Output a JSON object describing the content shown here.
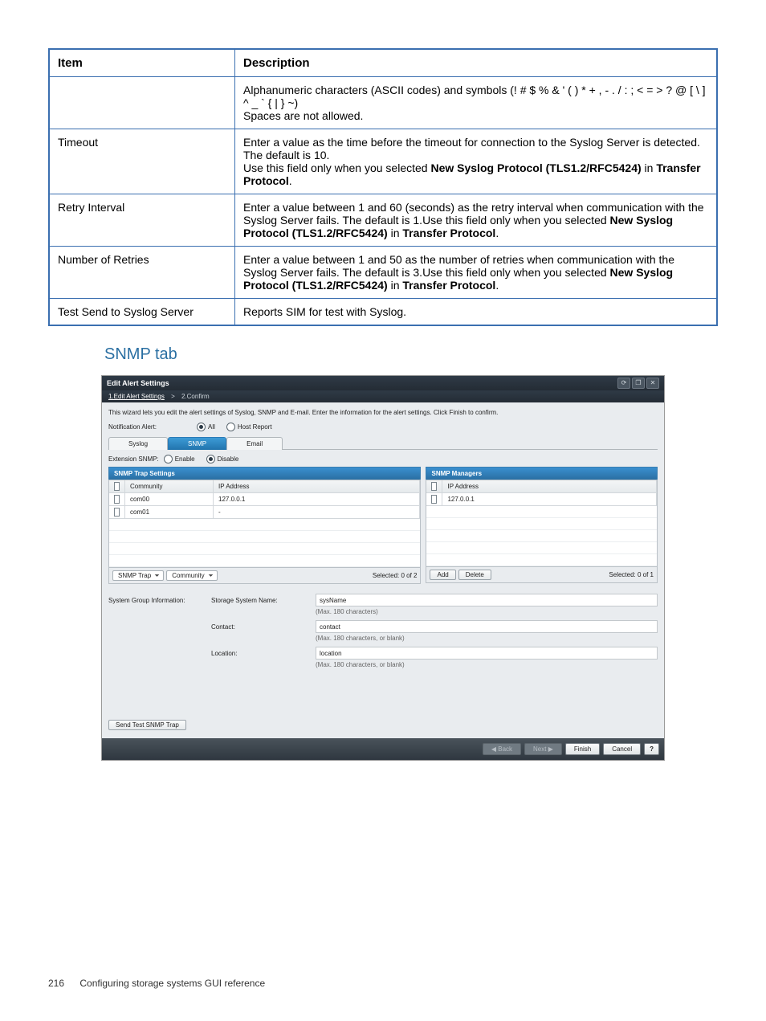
{
  "table": {
    "headers": [
      "Item",
      "Description"
    ],
    "rows": [
      {
        "item": "",
        "desc_html": "Alphanumeric characters (ASCII codes) and symbols (! # $ % & ' ( ) * + , - . / : ; < = > ? @ [ \\ ] ^ _ ` { | } ~)<br>Spaces are not allowed."
      },
      {
        "item": "Timeout",
        "desc_html": "Enter a value as the time before the timeout for connection to the Syslog Server is detected. The default is 10.<br>Use this field only when you selected <b>New Syslog Protocol (TLS1.2/RFC5424)</b> in <b>Transfer Protocol</b>."
      },
      {
        "item": "Retry Interval",
        "desc_html": "Enter a value between 1 and 60 (seconds) as the retry interval when communication with the Syslog Server fails. The default is 1.Use this field only when you selected <b>New Syslog Protocol (TLS1.2/RFC5424)</b> in <b>Transfer Protocol</b>."
      },
      {
        "item": "Number of Retries",
        "desc_html": "Enter a value between 1 and 50 as the number of retries when communication with the Syslog Server fails. The default is 3.Use this field only when you selected <b>New Syslog Protocol (TLS1.2/RFC5424)</b> in <b>Transfer Protocol</b>."
      },
      {
        "item": "Test Send to Syslog Server",
        "desc_html": "Reports SIM for test with Syslog."
      }
    ]
  },
  "section_heading": "SNMP tab",
  "dialog": {
    "title": "Edit Alert Settings",
    "breadcrumb": {
      "step1": "1.Edit Alert Settings",
      "sep": ">",
      "step2": "2.Confirm"
    },
    "wizard_text": "This wizard lets you edit the alert settings of Syslog, SNMP and E-mail. Enter the information for the alert settings. Click Finish to confirm.",
    "notif_alert_label": "Notification Alert:",
    "notif_all": "All",
    "notif_host": "Host Report",
    "tabs": {
      "syslog": "Syslog",
      "snmp": "SNMP",
      "email": "Email"
    },
    "ext_label": "Extension SNMP:",
    "ext_enable": "Enable",
    "ext_disable": "Disable",
    "trap_panel": {
      "title": "SNMP Trap Settings",
      "col1": "Community",
      "col2": "IP Address",
      "rows": [
        {
          "community": "com00",
          "ip": "127.0.0.1"
        },
        {
          "community": "com01",
          "ip": "-"
        }
      ],
      "dd1": "SNMP Trap",
      "dd2": "Community",
      "selected": "Selected: 0  of 2"
    },
    "mgr_panel": {
      "title": "SNMP Managers",
      "col1": "IP Address",
      "rows": [
        {
          "ip": "127.0.0.1"
        }
      ],
      "add": "Add",
      "delete": "Delete",
      "selected": "Selected: 0  of 1"
    },
    "sgi": {
      "heading": "System Group Information:",
      "name_label": "Storage System Name:",
      "name_value": "sysName",
      "name_hint": "(Max. 180 characters)",
      "contact_label": "Contact:",
      "contact_value": "contact",
      "contact_hint": "(Max. 180 characters, or blank)",
      "location_label": "Location:",
      "location_value": "location",
      "location_hint": "(Max. 180 characters, or blank)"
    },
    "send_trap": "Send Test SNMP Trap",
    "footer": {
      "back": "◀ Back",
      "next": "Next ▶",
      "finish": "Finish",
      "cancel": "Cancel",
      "help": "?"
    }
  },
  "page_footer": {
    "num": "216",
    "text": "Configuring storage systems GUI reference"
  }
}
